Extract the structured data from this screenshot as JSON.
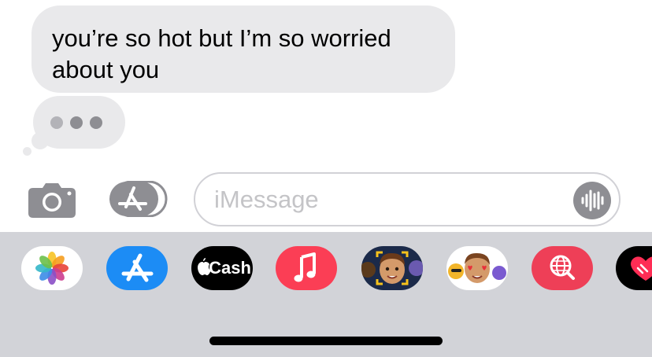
{
  "conversation": {
    "received_message": "you’re so hot but I’m so worried about you"
  },
  "compose": {
    "placeholder": "iMessage",
    "value": ""
  },
  "app_drawer": {
    "apps": [
      {
        "name": "Photos",
        "icon": "photos-icon"
      },
      {
        "name": "App Store",
        "icon": "app-store-icon"
      },
      {
        "name": "Apple Cash",
        "icon": "apple-cash-icon",
        "label": "Cash"
      },
      {
        "name": "Music",
        "icon": "music-icon"
      },
      {
        "name": "Memoji",
        "icon": "memoji-icon"
      },
      {
        "name": "Memoji Stickers",
        "icon": "memoji-stickers-icon"
      },
      {
        "name": "Images Search",
        "icon": "globe-search-icon"
      },
      {
        "name": "Digital Touch",
        "icon": "heart-icon"
      }
    ]
  },
  "colors": {
    "bubble_gray": "#e9e9eb",
    "tray_background": "#d2d3d8",
    "app_store_blue": "#1c8cf5",
    "music_red": "#fb3e55",
    "search_red": "#ee3f57"
  }
}
